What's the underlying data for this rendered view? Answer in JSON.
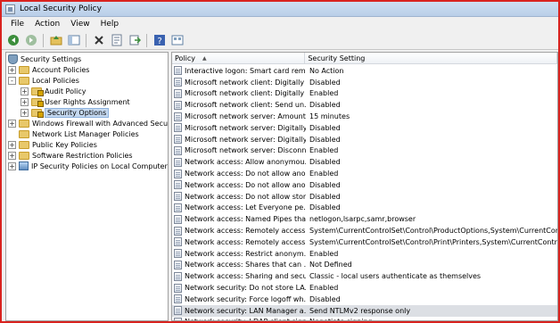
{
  "window": {
    "title": "Local Security Policy"
  },
  "menu": [
    "File",
    "Action",
    "View",
    "Help"
  ],
  "toolbar": {
    "buttons": [
      "back-icon",
      "forward-icon",
      "up-folder-icon",
      "show-hide-tree-icon",
      "delete-icon",
      "properties-icon",
      "export-list-icon",
      "help-icon",
      "view-icon"
    ]
  },
  "tree": {
    "items": [
      {
        "label": "Security Settings",
        "icon": "shield-icon",
        "expander": ""
      },
      {
        "label": "Account Policies",
        "icon": "folder-icon",
        "expander": "+"
      },
      {
        "label": "Local Policies",
        "icon": "folder-icon",
        "expander": "-"
      },
      {
        "label": "Audit Policy",
        "icon": "locked-folder-icon",
        "expander": "+"
      },
      {
        "label": "User Rights Assignment",
        "icon": "locked-folder-icon",
        "expander": "+"
      },
      {
        "label": "Security Options",
        "icon": "locked-folder-icon",
        "expander": "+"
      },
      {
        "label": "Windows Firewall with Advanced Security",
        "icon": "folder-icon",
        "expander": "+"
      },
      {
        "label": "Network List Manager Policies",
        "icon": "folder-icon",
        "expander": ""
      },
      {
        "label": "Public Key Policies",
        "icon": "folder-icon",
        "expander": "+"
      },
      {
        "label": "Software Restriction Policies",
        "icon": "folder-icon",
        "expander": "+"
      },
      {
        "label": "IP Security Policies on Local Computer",
        "icon": "network-icon",
        "expander": "+"
      }
    ]
  },
  "table": {
    "col_policy": "Policy",
    "col_setting": "Security Setting",
    "rows": [
      {
        "policy": "Interactive logon: Smart card rem...",
        "setting": "No Action"
      },
      {
        "policy": "Microsoft network client: Digitally ...",
        "setting": "Disabled"
      },
      {
        "policy": "Microsoft network client: Digitally ...",
        "setting": "Enabled"
      },
      {
        "policy": "Microsoft network client: Send un...",
        "setting": "Disabled"
      },
      {
        "policy": "Microsoft network server: Amount...",
        "setting": "15 minutes"
      },
      {
        "policy": "Microsoft network server: Digitally...",
        "setting": "Disabled"
      },
      {
        "policy": "Microsoft network server: Digitally...",
        "setting": "Disabled"
      },
      {
        "policy": "Microsoft network server: Disconn...",
        "setting": "Enabled"
      },
      {
        "policy": "Network access: Allow anonymou...",
        "setting": "Disabled"
      },
      {
        "policy": "Network access: Do not allow ano...",
        "setting": "Enabled"
      },
      {
        "policy": "Network access: Do not allow ano...",
        "setting": "Disabled"
      },
      {
        "policy": "Network access: Do not allow stor...",
        "setting": "Disabled"
      },
      {
        "policy": "Network access: Let Everyone pe...",
        "setting": "Disabled"
      },
      {
        "policy": "Network access: Named Pipes tha...",
        "setting": "netlogon,lsarpc,samr,browser"
      },
      {
        "policy": "Network access: Remotely accessi...",
        "setting": "System\\CurrentControlSet\\Control\\ProductOptions,System\\CurrentControlSe"
      },
      {
        "policy": "Network access: Remotely accessi...",
        "setting": "System\\CurrentControlSet\\Control\\Print\\Printers,System\\CurrentControlSet\\"
      },
      {
        "policy": "Network access: Restrict anonym...",
        "setting": "Enabled"
      },
      {
        "policy": "Network access: Shares that can ...",
        "setting": "Not Defined"
      },
      {
        "policy": "Network access: Sharing and secu...",
        "setting": "Classic - local users authenticate as themselves"
      },
      {
        "policy": "Network security: Do not store LA...",
        "setting": "Enabled"
      },
      {
        "policy": "Network security: Force logoff wh...",
        "setting": "Disabled"
      },
      {
        "policy": "Network security: LAN Manager a...",
        "setting": "Send NTLMv2 response only"
      },
      {
        "policy": "Network security: LDAP client sign...",
        "setting": "Negotiate signing"
      }
    ]
  }
}
